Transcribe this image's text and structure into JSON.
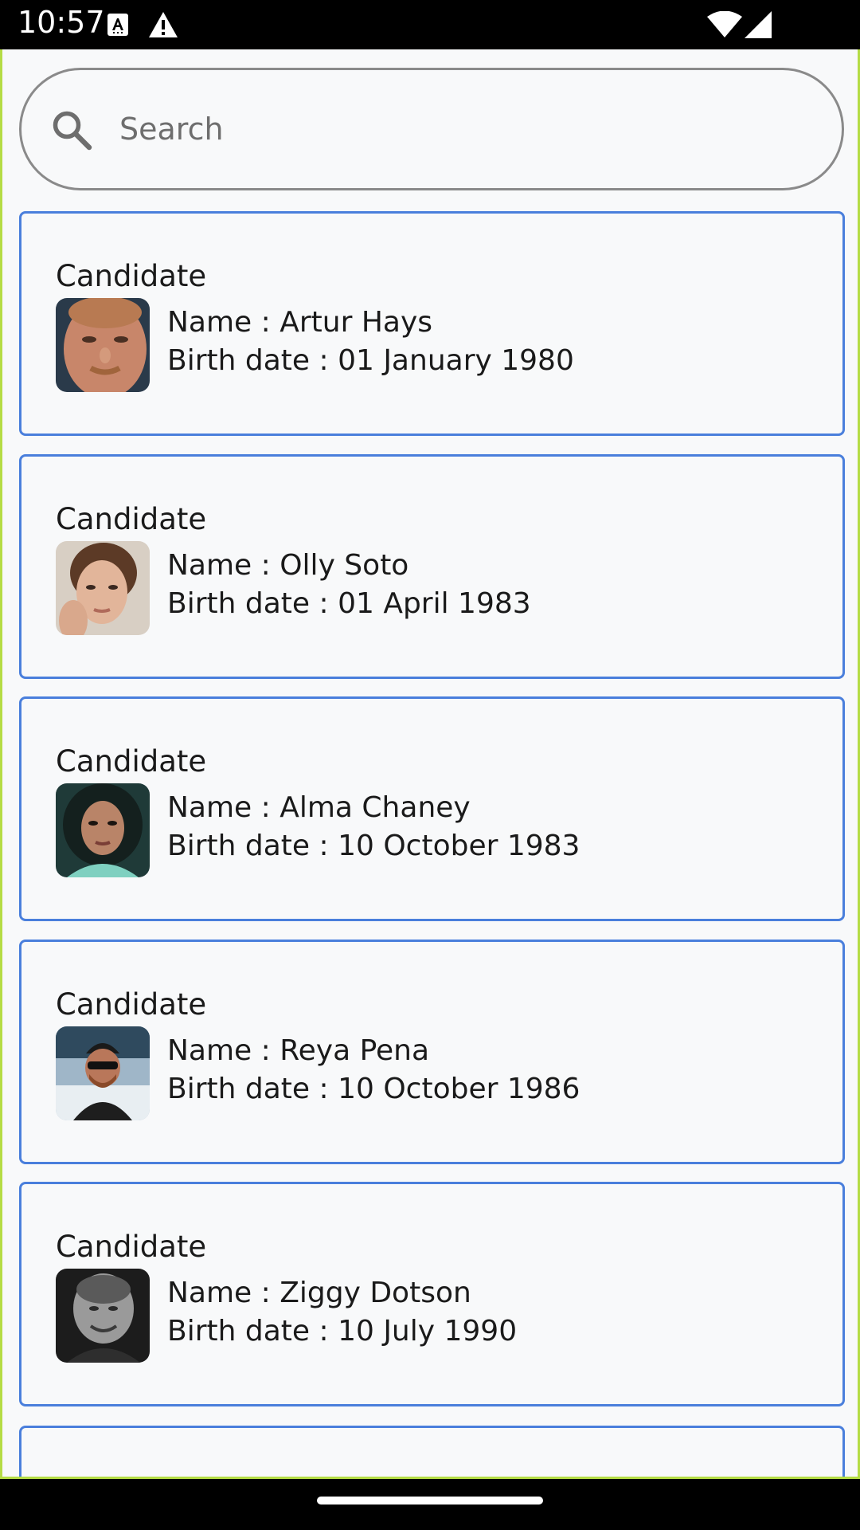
{
  "status_bar": {
    "time": "10:57",
    "icons": [
      "text-recognition-icon",
      "warning-icon",
      "wifi-icon",
      "cellular-signal-icon"
    ]
  },
  "search": {
    "placeholder": "Search",
    "value": "",
    "icon": "search-icon"
  },
  "candidates": [
    {
      "title": "Candidate",
      "name": "Name : Artur Hays",
      "birth": "Birth date : 01 January 1980",
      "avatar": "portrait-photo"
    },
    {
      "title": "Candidate",
      "name": "Name : Olly Soto",
      "birth": "Birth date : 01 April 1983",
      "avatar": "portrait-photo"
    },
    {
      "title": "Candidate",
      "name": "Name : Alma Chaney",
      "birth": "Birth date : 10 October 1983",
      "avatar": "portrait-photo"
    },
    {
      "title": "Candidate",
      "name": "Name : Reya Pena",
      "birth": "Birth date : 10 October 1986",
      "avatar": "portrait-photo"
    },
    {
      "title": "Candidate",
      "name": "Name : Ziggy Dotson",
      "birth": "Birth date : 10 July 1990",
      "avatar": "portrait-photo"
    }
  ],
  "colors": {
    "card_border": "#4a7fdc",
    "app_frame": "#b5dc45",
    "background": "#f8f9fa",
    "text": "#1a1a1a"
  }
}
